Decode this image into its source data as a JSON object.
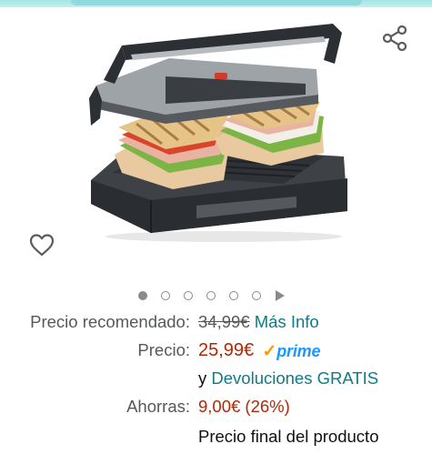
{
  "icons": {
    "share": "share-icon",
    "wishlist": "heart-outline-icon",
    "prime_check": "checkmark-icon"
  },
  "colors": {
    "price": "#b12704",
    "link": "#0f7a8a",
    "prime_blue": "#1a98ff",
    "prime_check": "#ff9900"
  },
  "gallery": {
    "image_count": 6,
    "active_index": 0
  },
  "pricing": {
    "recommended_label": "Precio recomendado:",
    "recommended_value": "34,99€",
    "more_info_link": "Más Info",
    "price_label": "Precio:",
    "price_value": "25,99€",
    "prime_check": "✓",
    "prime_word": "prime",
    "returns_prefix": "y",
    "returns_link": "Devoluciones GRATIS",
    "savings_label": "Ahorras:",
    "savings_value": "9,00€ (26%)",
    "final_price_note": "Precio final del producto"
  }
}
